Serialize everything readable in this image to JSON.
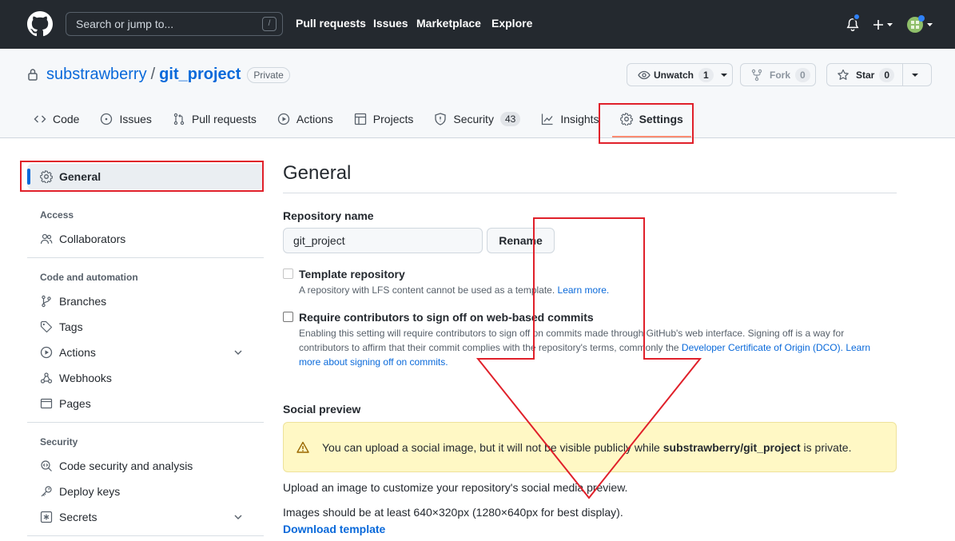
{
  "header": {
    "search_placeholder": "Search or jump to...",
    "search_shortcut": "/",
    "nav": [
      "Pull requests",
      "Issues",
      "Marketplace",
      "Explore"
    ]
  },
  "repo": {
    "owner": "substrawberry",
    "separator": "/",
    "name": "git_project",
    "visibility": "Private",
    "watch_label": "Unwatch",
    "watch_count": "1",
    "fork_label": "Fork",
    "fork_count": "0",
    "star_label": "Star",
    "star_count": "0"
  },
  "tabs": [
    {
      "label": "Code",
      "icon": "code-icon"
    },
    {
      "label": "Issues",
      "icon": "issue-icon"
    },
    {
      "label": "Pull requests",
      "icon": "pull-request-icon"
    },
    {
      "label": "Actions",
      "icon": "play-icon"
    },
    {
      "label": "Projects",
      "icon": "table-icon"
    },
    {
      "label": "Security",
      "icon": "shield-icon",
      "count": "43"
    },
    {
      "label": "Insights",
      "icon": "graph-icon"
    },
    {
      "label": "Settings",
      "icon": "gear-icon",
      "active": true
    }
  ],
  "sidebar": {
    "general": "General",
    "access_heading": "Access",
    "collaborators": "Collaborators",
    "code_heading": "Code and automation",
    "branches": "Branches",
    "tags": "Tags",
    "actions": "Actions",
    "webhooks": "Webhooks",
    "pages": "Pages",
    "security_heading": "Security",
    "code_security": "Code security and analysis",
    "deploy_keys": "Deploy keys",
    "secrets": "Secrets"
  },
  "main": {
    "title": "General",
    "repo_name_label": "Repository name",
    "repo_name_value": "git_project",
    "rename_button": "Rename",
    "template_label": "Template repository",
    "template_note": "A repository with LFS content cannot be used as a template.",
    "template_learn_more": "Learn more.",
    "signoff_label": "Require contributors to sign off on web-based commits",
    "signoff_note_1": "Enabling this setting will require contributors to sign off on commits made through GitHub's web interface. Signing off is a way for contributors to affirm that their commit complies with the repository's terms, commonly the ",
    "signoff_dco_link": "Developer Certificate of Origin (DCO).",
    "signoff_learn_more": "Learn more about signing off on commits.",
    "social_heading": "Social preview",
    "flash_text_1": "You can upload a social image, but it will not be visible publicly while ",
    "flash_repo": "substrawberry/git_project",
    "flash_text_2": " is private.",
    "upload_text": "Upload an image to customize your repository's social media preview.",
    "size_text": "Images should be at least 640×320px (1280×640px for best display).",
    "download_link": "Download template"
  },
  "colors": {
    "header_bg": "#24292f",
    "link": "#0969da",
    "annotation": "#e0202a",
    "flash_bg": "#fff8c5"
  }
}
